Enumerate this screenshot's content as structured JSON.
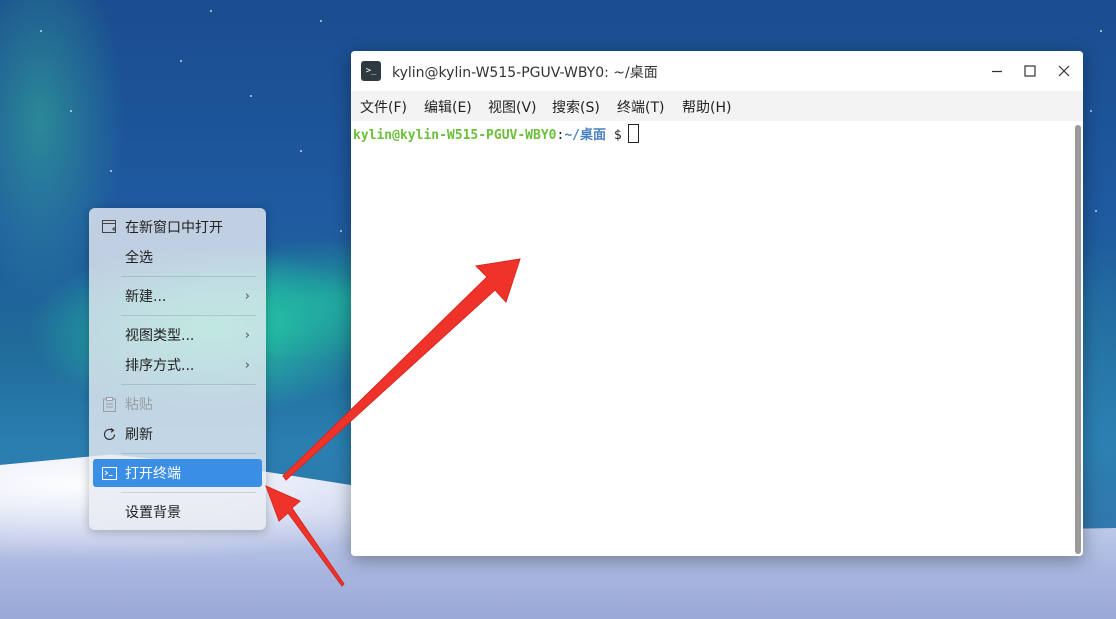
{
  "context_menu": {
    "items": [
      {
        "label": "在新窗口中打开",
        "icon": "new-window-icon"
      },
      {
        "label": "全选"
      },
      {
        "label": "新建...",
        "submenu": true
      },
      {
        "label": "视图类型...",
        "submenu": true
      },
      {
        "label": "排序方式...",
        "submenu": true
      },
      {
        "label": "粘贴",
        "icon": "paste-icon",
        "disabled": true
      },
      {
        "label": "刷新",
        "icon": "refresh-icon"
      },
      {
        "label": "打开终端",
        "icon": "terminal-icon",
        "highlighted": true
      },
      {
        "label": "设置背景"
      }
    ],
    "submenu_glyph": "›"
  },
  "terminal": {
    "title": "kylin@kylin-W515-PGUV-WBY0: ~/桌面",
    "menus": [
      "文件(F)",
      "编辑(E)",
      "视图(V)",
      "搜索(S)",
      "终端(T)",
      "帮助(H)"
    ],
    "prompt": {
      "user_host": "kylin@kylin-W515-PGUV-WBY0",
      "colon": ":",
      "path": "~/桌面",
      "sign": "$"
    }
  },
  "colors": {
    "highlight": "#3a8ee6",
    "arrow": "#f0332a",
    "prompt_user": "#6bbf3a",
    "prompt_path": "#4a82c3"
  }
}
